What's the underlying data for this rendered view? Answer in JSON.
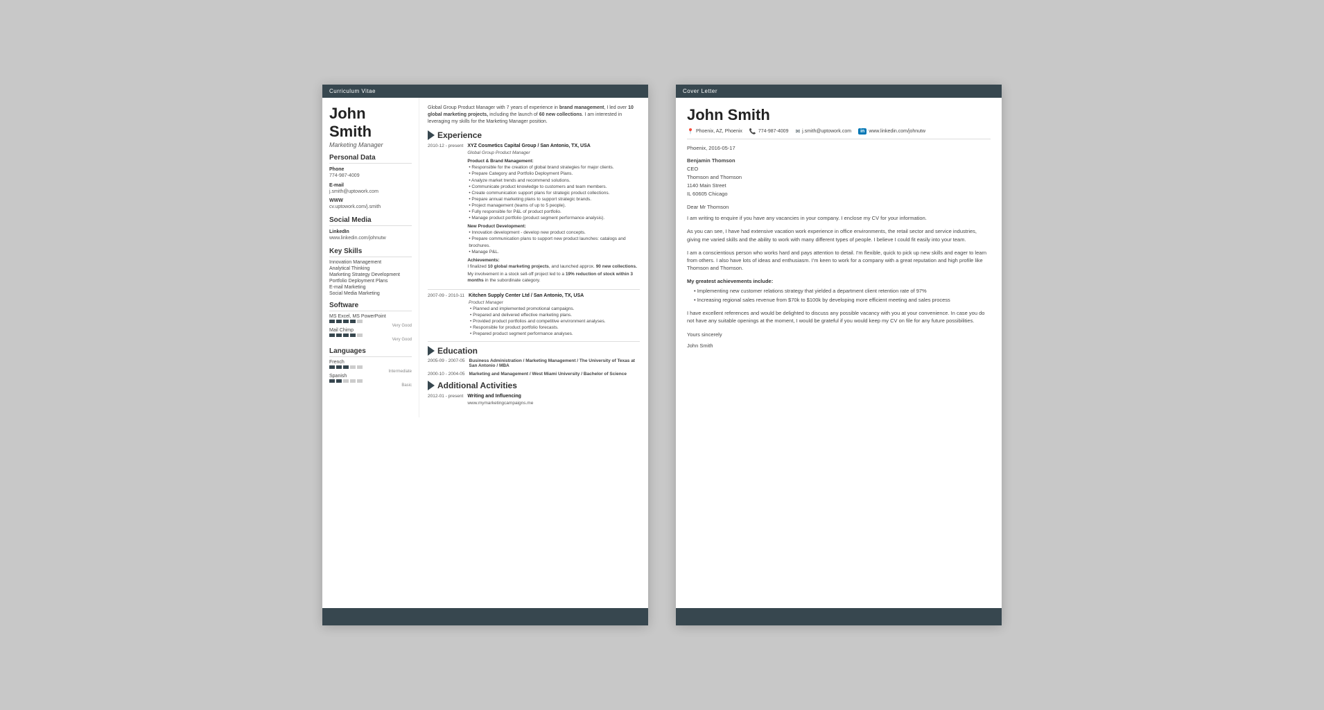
{
  "cv": {
    "header": "Curriculum Vitae",
    "name": "John Smith",
    "title": "Marketing Manager",
    "summary": "Global Group Product Manager with 7 years of experience in brand management, I led over 10 global marketing projects, including the launch of 60 new collections. I am interested in leveraging my skills for the Marketing Manager position.",
    "sidebar": {
      "personal_data_title": "Personal Data",
      "phone_label": "Phone",
      "phone_value": "774-987-4009",
      "email_label": "E-mail",
      "email_value": "j.smith@uptowork.com",
      "www_label": "WWW",
      "www_value": "cv.uptowork.com/j.smith",
      "social_media_title": "Social Media",
      "linkedin_label": "LinkedIn",
      "linkedin_value": "www.linkedin.com/johnutw",
      "key_skills_title": "Key Skills",
      "skills": [
        "Innovation Management",
        "Analytical Thinking",
        "Marketing Strategy Development",
        "Portfolio Deployment Plans",
        "E-mail Marketing",
        "Social Media Marketing"
      ],
      "software_title": "Software",
      "software_items": [
        {
          "name": "MS Excel, MS PowerPoint",
          "rating": 4,
          "max": 5,
          "label": "Very Good"
        },
        {
          "name": "Mail Chimp",
          "rating": 4,
          "max": 5,
          "label": "Very Good"
        }
      ],
      "languages_title": "Languages",
      "languages": [
        {
          "name": "French",
          "rating": 3,
          "max": 5,
          "label": "Intermediate"
        },
        {
          "name": "Spanish",
          "rating": 2,
          "max": 5,
          "label": "Basic"
        }
      ]
    },
    "experience_title": "Experience",
    "experience": [
      {
        "dates": "2010-12 - present",
        "company": "XYZ Cosmetics Capital Group / San Antonio, TX, USA",
        "job_title": "Global Group Product Manager",
        "section1_title": "Product & Brand Management:",
        "bullets1": [
          "Responsible for the creation of global brand strategies for major clients.",
          "Prepare Category and Portfolio Deployment Plans.",
          "Analyze market trends and recommend solutions.",
          "Communicate product knowledge to customers and team members.",
          "Create communication support plans for strategic product collections.",
          "Prepare annual marketing plans to support strategic brands.",
          "Project management (teams of up to 5 people).",
          "Fully responsible for P&L of product portfolio.",
          "Manage product portfolio (product segment performance analysis)."
        ],
        "section2_title": "New Product Development:",
        "bullets2": [
          "Innovation development - develop new product concepts.",
          "Prepare communication plans to support new product launches: catalogs and brochures.",
          "Manage P&L."
        ],
        "section3_title": "Achievements:",
        "achievements": [
          "I finalized 10 global marketing projects, and launched approx. 90 new collections.",
          "My involvement in a stock sell-off project led to a 19% reduction of stock within 3 months in the subordinate category."
        ]
      },
      {
        "dates": "2007-09 - 2010-11",
        "company": "Kitchen Supply Center Ltd / San Antonio, TX, USA",
        "job_title": "Product Manager",
        "bullets": [
          "Planned and implemented promotional campaigns.",
          "Prepared and delivered effective marketing plans.",
          "Provided product portfolios and competitive environment analyses.",
          "Responsible for product portfolio forecasts.",
          "Prepared product segment performance analyses."
        ]
      }
    ],
    "education_title": "Education",
    "education": [
      {
        "dates": "2005-09 - 2007-05",
        "degree": "Business Administration / Marketing Management / The University of Texas at San Antonio / MBA"
      },
      {
        "dates": "2000-10 - 2004-05",
        "degree": "Marketing and Management / West Miami University / Bachelor of Science"
      }
    ],
    "activities_title": "Additional Activities",
    "activities": [
      {
        "dates": "2012-01 - present",
        "title": "Writing and Influencing",
        "detail": "www.mymarketingcampaigns.me"
      }
    ]
  },
  "cover_letter": {
    "header": "Cover Letter",
    "name": "John Smith",
    "contact": {
      "location": "Phoenix, AZ, Phoenix",
      "phone": "774-987-4009",
      "email": "j.smith@uptowork.com",
      "linkedin": "www.linkedin.com/johnutw"
    },
    "date": "Phoenix, 2016-05-17",
    "recipient_name": "Benjamin Thomson",
    "recipient_title": "CEO",
    "recipient_company": "Thomson and Thomson",
    "recipient_address": "1140 Main Street",
    "recipient_city": "IL 60605 Chicago",
    "salutation": "Dear Mr Thomson",
    "paragraph1": "I am writing to enquire if you have any vacancies in your company. I enclose my CV for your information.",
    "paragraph2": "As you can see, I have had extensive vacation work experience in office environments, the retail sector and service industries, giving me varied skills and the ability to work with many different types of people. I believe I could fit easily into your team.",
    "paragraph3": "I am a conscientious person who works hard and pays attention to detail. I'm flexible, quick to pick up new skills and eager to learn from others. I also have lots of ideas and enthusiasm. I'm keen to work for a company with a great reputation and high profile like Thomson and Thomson.",
    "achievements_title": "My greatest achievements include:",
    "achievements": [
      "Implementing new customer relations strategy that yielded a department client retention rate of 97%",
      "Increasing regional sales revenue from $70k to $100k by developing more efficient meeting and sales process"
    ],
    "closing_paragraph": "I have excellent references and would be delighted to discuss any possible vacancy with you at your convenience. In case you do not have any suitable openings at the moment, I would be grateful if you would keep my CV on file for any future possibilities.",
    "yours_sincerely": "Yours sincerely",
    "signature": "John Smith"
  }
}
